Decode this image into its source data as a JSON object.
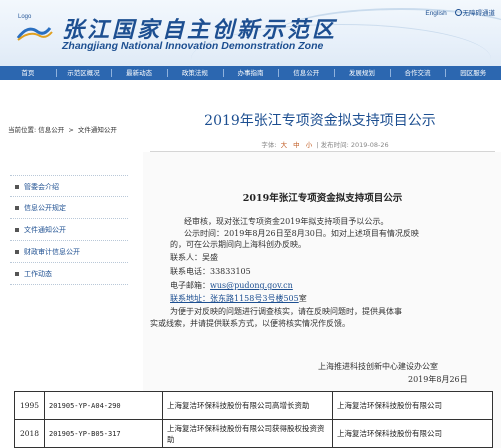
{
  "header": {
    "logo_text": "Logo",
    "title": "张江国家自主创新示范区",
    "subtitle": "Zhangjiang National Innovation Demonstration Zone",
    "lang_link": "English",
    "accessibility_link": "无障碍通道"
  },
  "nav": {
    "items": [
      "首页",
      "示范区概况",
      "最新动态",
      "政策法规",
      "办事指南",
      "信息公开",
      "发展规划",
      "合作交流",
      "园区服务"
    ]
  },
  "breadcrumb": {
    "prefix": "当前位置:",
    "items": [
      "信息公开",
      "文件通知公开"
    ],
    "separator": ">"
  },
  "article": {
    "title": "2019年张江专项资金拟支持项目公示",
    "meta_font_label": "字体:",
    "font_sizes": [
      "大",
      "中",
      "小"
    ],
    "publish_label": "发布时间:",
    "publish_date": "2019-08-26"
  },
  "sidebar": {
    "items": [
      "管委会介绍",
      "信息公开规定",
      "文件通知公开",
      "财政审计信息公开",
      "工作动态"
    ]
  },
  "body": {
    "heading": "2019年张江专项资金拟支持项目公示",
    "p1": "经审核，现对张江专项资金2019年拟支持项目予以公示。",
    "p2_line1": "公示时间：2019年8月26日至8月30日。如对上述项目有情况反映",
    "p2_line2": "的，可在公示期间向上海科创办反映。",
    "contact_label": "联系人：",
    "contact_name": "吴盛",
    "phone_label": "联系电话：",
    "phone": "33833105",
    "email_label": "电子邮箱：",
    "email": "wus@pudong.gov.cn",
    "address_label": "联系地址：",
    "address": "张东路1158号3号楼505",
    "address_suffix": "室",
    "p3_line1": "为便于对反映的问题进行调查核实，请在反映问题时，提供具体事",
    "p3_line2": "实或线索，并请提供联系方式，以便将核实情况作反馈。",
    "signature": "上海推进科技创新中心建设办公室",
    "date": "2019年8月26日"
  },
  "table": {
    "rows": [
      {
        "no": "1995",
        "code": "201905-YP-A04-290",
        "project": "上海复洁环保科技股份有限公司高增长资助",
        "company": "上海复洁环保科技股份有限公司"
      },
      {
        "no": "2018",
        "code": "201905-YP-B05-317",
        "project": "上海复洁环保科技股份有限公司获得股权投资资助",
        "company": "上海复洁环保科技股份有限公司"
      }
    ]
  }
}
